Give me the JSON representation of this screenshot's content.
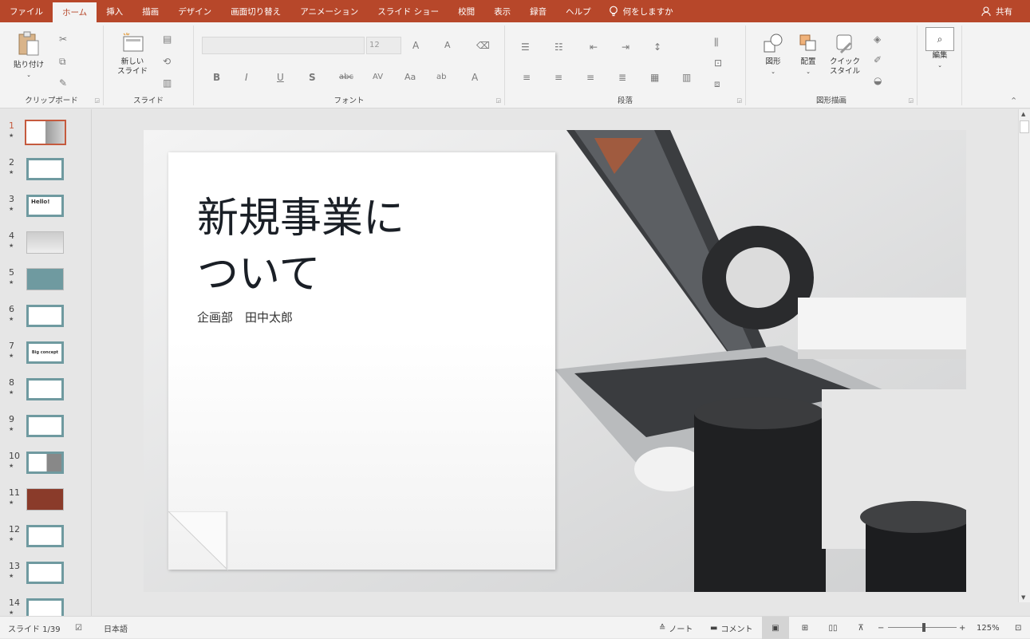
{
  "ribbon_tabs": [
    {
      "label": "ファイル"
    },
    {
      "label": "ホーム"
    },
    {
      "label": "挿入"
    },
    {
      "label": "描画"
    },
    {
      "label": "デザイン"
    },
    {
      "label": "画面切り替え"
    },
    {
      "label": "アニメーション"
    },
    {
      "label": "スライド ショー"
    },
    {
      "label": "校閲"
    },
    {
      "label": "表示"
    },
    {
      "label": "録音"
    },
    {
      "label": "ヘルプ"
    }
  ],
  "tell_me": "何をしますか",
  "share": "共有",
  "clipboard": {
    "paste": "貼り付け",
    "label": "クリップボード"
  },
  "slides_group": {
    "new_slide_1": "新しい",
    "new_slide_2": "スライド",
    "label": "スライド"
  },
  "font_group": {
    "size": "12",
    "label": "フォント"
  },
  "paragraph_group": {
    "label": "段落"
  },
  "drawing_group": {
    "shapes": "図形",
    "arrange": "配置",
    "quick_1": "クイック",
    "quick_2": "スタイル",
    "label": "図形描画"
  },
  "editing": {
    "label": "編集"
  },
  "thumbnails": [
    {
      "num": "1"
    },
    {
      "num": "2"
    },
    {
      "num": "3",
      "text": "Hello!"
    },
    {
      "num": "4"
    },
    {
      "num": "5"
    },
    {
      "num": "6"
    },
    {
      "num": "7",
      "text": "Big concept"
    },
    {
      "num": "8"
    },
    {
      "num": "9"
    },
    {
      "num": "10"
    },
    {
      "num": "11"
    },
    {
      "num": "12"
    },
    {
      "num": "13"
    },
    {
      "num": "14"
    }
  ],
  "slide": {
    "title": "新規事業に\nついて",
    "subtitle": "企画部　田中太郎"
  },
  "status": {
    "slide_count": "スライド 1/39",
    "language": "日本語",
    "notes": "ノート",
    "comments": "コメント",
    "zoom": "125%"
  },
  "colors": {
    "accent": "#b7472a",
    "thumb_teal": "#6f9aa0"
  }
}
